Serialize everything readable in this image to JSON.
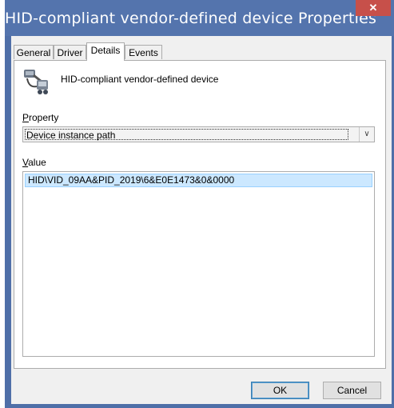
{
  "window": {
    "title": "HID-compliant vendor-defined device Properties",
    "close_glyph": "✕"
  },
  "tabs": [
    {
      "label": "General"
    },
    {
      "label": "Driver"
    },
    {
      "label": "Details"
    },
    {
      "label": "Events"
    }
  ],
  "active_tab": "Details",
  "device": {
    "name": "HID-compliant vendor-defined device",
    "icon": "hid-device-icon"
  },
  "property": {
    "label_accel": "P",
    "label_rest": "roperty",
    "selected": "Device instance path"
  },
  "value": {
    "label_accel": "V",
    "label_rest": "alue",
    "items": [
      "HID\\VID_09AA&PID_2019\\6&E0E1473&0&0000"
    ]
  },
  "buttons": {
    "ok": "OK",
    "cancel": "Cancel"
  },
  "colors": {
    "titlebar": "#5474ad",
    "close": "#c7504a",
    "selection": "#cce8ff"
  }
}
